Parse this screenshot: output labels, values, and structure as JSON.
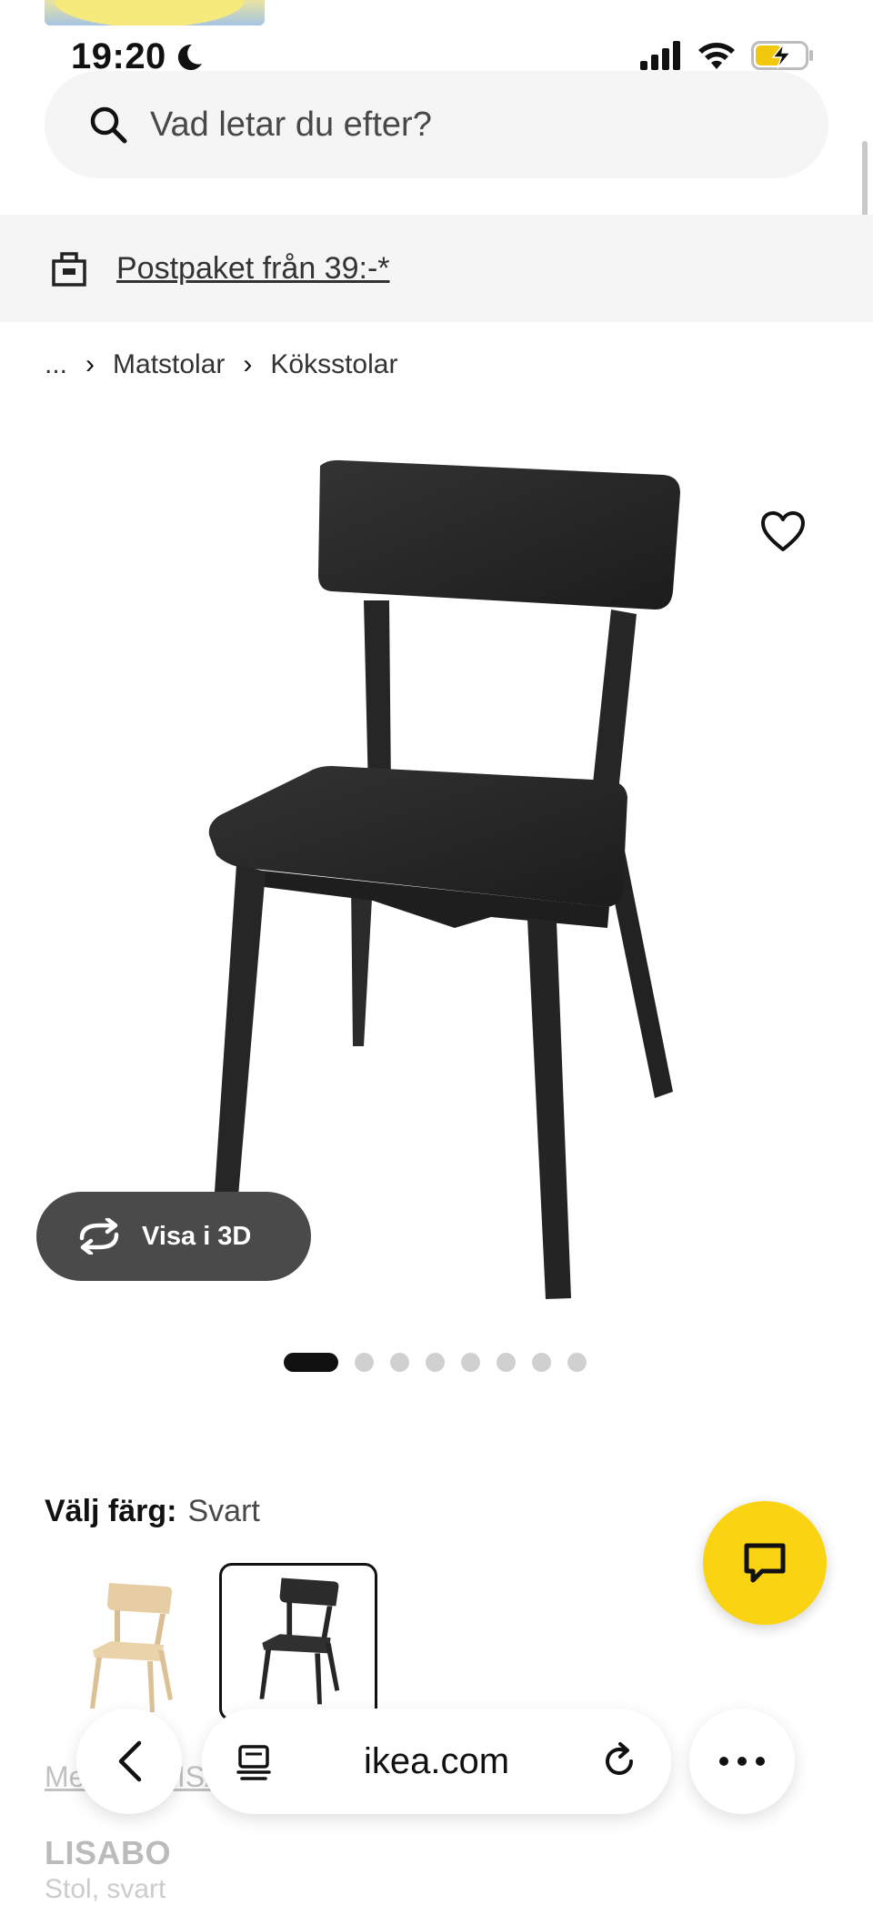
{
  "status": {
    "time": "19:20",
    "icons": [
      "moon-icon",
      "cellular-signal-icon",
      "wifi-icon",
      "battery-charging-icon"
    ]
  },
  "search": {
    "placeholder": "Vad letar du efter?"
  },
  "promo": {
    "text": "Postpaket från 39:-*"
  },
  "breadcrumb": {
    "items": [
      "...",
      "Matstolar",
      "Köksstolar"
    ],
    "separator": "›"
  },
  "gallery": {
    "view3d_label": "Visa i 3D",
    "image_count": 8,
    "active_index": 0
  },
  "color": {
    "label": "Välj färg:",
    "value": "Svart",
    "options": [
      {
        "name": "birch",
        "color": "#e8cfa6",
        "selected": false
      },
      {
        "name": "black",
        "color": "#2b2b2b",
        "selected": true
      }
    ]
  },
  "product": {
    "series_link": "Mer från LISABO-serien",
    "name": "LISABO",
    "subtitle": "Stol, svart"
  },
  "browser": {
    "url": "ikea.com"
  },
  "colors": {
    "accent_yellow": "#fad312",
    "dark_button": "#4a4a4a",
    "chair": "#262626"
  }
}
